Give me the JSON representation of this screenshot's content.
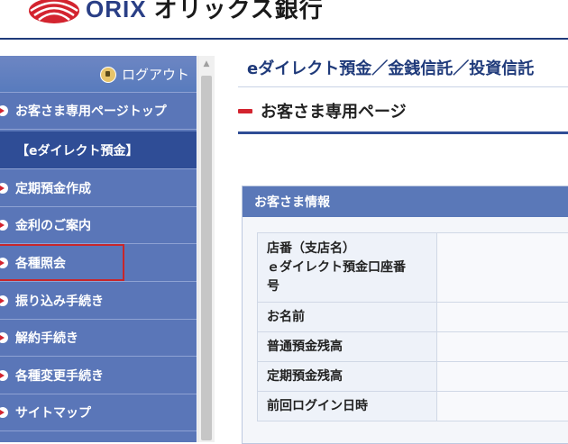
{
  "header": {
    "logo_latin": "ORIX",
    "bank_name": "オリックス銀行"
  },
  "sidebar": {
    "logout_label": "ログアウト",
    "items": [
      {
        "label": "お客さま専用ページトップ"
      },
      {
        "label": "【eダイレクト預金】"
      },
      {
        "label": "定期預金作成"
      },
      {
        "label": "金利のご案内"
      },
      {
        "label": "各種照会"
      },
      {
        "label": "振り込み手続き"
      },
      {
        "label": "解約手続き"
      },
      {
        "label": "各種変更手続き"
      },
      {
        "label": "サイトマップ"
      }
    ]
  },
  "main": {
    "title": "eダイレクト預金／金銭信託／投資信託",
    "page_title": "お客さま専用ページ",
    "panel_title": "お客さま情報",
    "rows": [
      {
        "label_line1": "店番（支店名）",
        "label_line2": "ｅダイレクト預金口座番",
        "label_line3": "号",
        "value": ""
      },
      {
        "label": "お名前",
        "value": ""
      },
      {
        "label": "普通預金残高",
        "value": ""
      },
      {
        "label": "定期預金残高",
        "value": ""
      },
      {
        "label": "前回ログイン日時",
        "value": ""
      }
    ]
  },
  "colors": {
    "brand_navy": "#1f3a7a",
    "sidebar_blue": "#5a76b8",
    "accent_red": "#d3242f"
  }
}
